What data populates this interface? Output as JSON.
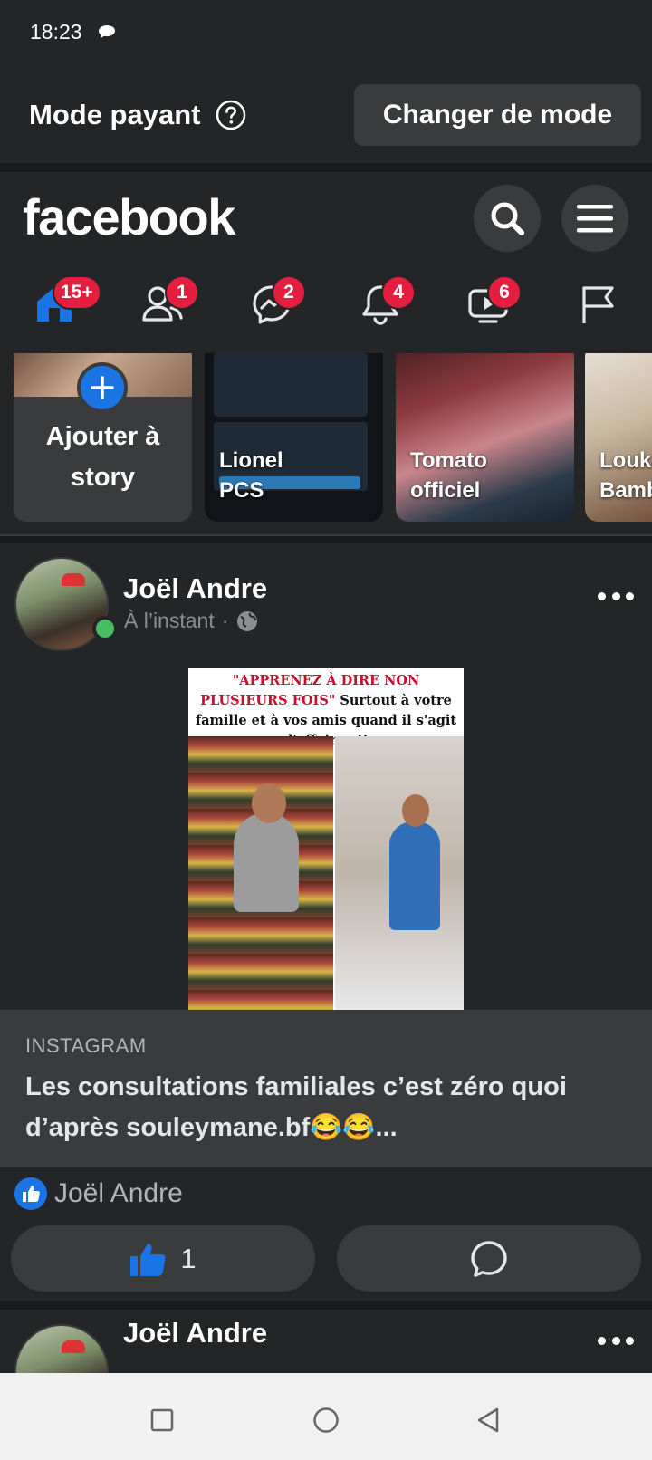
{
  "status_bar": {
    "time": "18:23"
  },
  "mode_bar": {
    "label": "Mode payant",
    "change_button": "Changer de mode"
  },
  "header": {
    "logo": "facebook"
  },
  "nav": {
    "home_badge": "15+",
    "friends_badge": "1",
    "messenger_badge": "2",
    "notifications_badge": "4",
    "video_badge": "6"
  },
  "stories": [
    {
      "name": "Ajouter à story"
    },
    {
      "name": "Lionel PCS"
    },
    {
      "name": "Tomato officiel"
    },
    {
      "name": "Louka Bamb"
    }
  ],
  "post": {
    "author": "Joël Andre",
    "time": "À l’instant",
    "image_caption_red": "\"APPRENEZ À DIRE NON PLUSIEURS FOIS\"",
    "image_caption_rest": " Surtout à votre famille et à vos amis quand il s'agit d'affaires !!",
    "link_source": "INSTAGRAM",
    "link_title": "Les consultations familiales c’est zéro quoi d’après souleymane.bf😂😂...",
    "reaction_name": "Joël Andre",
    "like_count": "1"
  },
  "post2": {
    "author": "Joël Andre"
  },
  "colors": {
    "accent": "#1b74e4",
    "badge": "#e41e3f",
    "online": "#45bd62"
  }
}
